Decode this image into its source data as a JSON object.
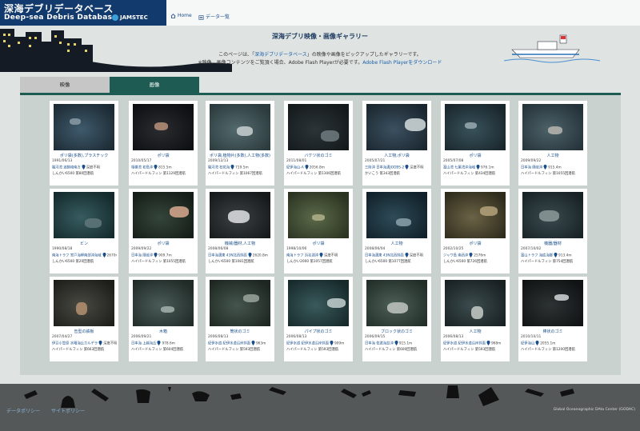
{
  "header": {
    "title_ja": "深海デブリデータベース",
    "title_en": "Deep-sea Debris Database",
    "org": "JAMSTEC",
    "nav": [
      {
        "label": "Home"
      },
      {
        "label": "データ一覧"
      }
    ]
  },
  "page": {
    "title": "深海デブリ映像・画像ギャラリー",
    "intro_before": "このページは、「",
    "intro_link": "深海デブリデータベース",
    "intro_after": "」の映像や画像をピックアップしたギャラリーです。",
    "note": "※映像、画像コンテンツをご覧頂く場合、Adobe Flash Playerが必要です。",
    "note_link": "Adobe Flash Playerをダウンロード"
  },
  "tabs": [
    {
      "label": "映像",
      "active": false
    },
    {
      "label": "画像",
      "active": true
    }
  ],
  "gallery": [
    {
      "title": "ポリ袋(多数),プラスチック",
      "date": "1991/06/13",
      "location": "駿河湾 波勝崎南方",
      "depth": "深度不明",
      "vehicle": "しんかい6500 第80回潜航"
    },
    {
      "title": "ポリ袋",
      "date": "2010/05/17",
      "location": "相模湾 初島沖",
      "depth": "815.5m",
      "vehicle": "ハイパードルフィン 第1129回潜航"
    },
    {
      "title": "ポリ袋,植物片(多数),人工物(多数)",
      "date": "2009/12/13",
      "location": "駿河湾 石花海",
      "depth": "719.5m",
      "vehicle": "ハイパードルフィン 第1067回潜航"
    },
    {
      "title": "バケツ状のゴミ",
      "date": "2011/08/01",
      "location": "紀伊海山-A",
      "depth": "2056.8m",
      "vehicle": "ハイパードルフィン 第1306回潜航"
    },
    {
      "title": "人工物,ポリ袋",
      "date": "2005/07/21",
      "location": "三陸沖 日本海溝JODBS-2",
      "depth": "深度不明",
      "vehicle": "かいこう 第343回潜航"
    },
    {
      "title": "ポリ袋",
      "date": "2005/07/08",
      "location": "富山湾 七尾湾沖海域",
      "depth": "976.1m",
      "vehicle": "ハイパードルフィン 第434回潜航"
    },
    {
      "title": "人工物",
      "date": "2009/09/22",
      "location": "日本海 隠岐沖",
      "depth": "915.4m",
      "vehicle": "ハイパードルフィン 第1055回潜航"
    },
    {
      "title": "ビン",
      "date": "1990/08/18",
      "location": "南海トラフ 室戸海岬南部沖海域",
      "depth": "2670m",
      "vehicle": "しんかい6500 第20回潜航"
    },
    {
      "title": "ポリ袋",
      "date": "2009/09/22",
      "location": "日本海 隠岐沖",
      "depth": "909.7m",
      "vehicle": "ハイパードルフィン 第1055回潜航"
    },
    {
      "title": "機械/器材,人工物",
      "date": "2008/06/08",
      "location": "日本海溝東 43N北西斜面",
      "depth": "2620.8m",
      "vehicle": "しんかい6500 第1081回潜航"
    },
    {
      "title": "ポリ袋",
      "date": "1998/10/06",
      "location": "南海トラフ 浜名湖沖",
      "depth": "深度不明",
      "vehicle": "しんかい2000 第1057回潜航"
    },
    {
      "title": "人工物",
      "date": "2008/06/04",
      "location": "日本海溝東 43N北西斜面",
      "depth": "深度不明",
      "vehicle": "しんかい6500 第1077回潜航"
    },
    {
      "title": "ポリ袋",
      "date": "2002/10/25",
      "location": "ジャワ島 南西沖",
      "depth": "2576m",
      "vehicle": "しんかい6500 第726回潜航"
    },
    {
      "title": "機器/器材",
      "date": "2007/10/02",
      "location": "富山トラフ 海底海脚",
      "depth": "913.4m",
      "vehicle": "ハイパードルフィン 第754回潜航"
    },
    {
      "title": "缶型の鉄板",
      "date": "2007/04/27",
      "location": "伊豆小笠原 水曜海丘カルデラ",
      "depth": "深度不明",
      "vehicle": "ハイパードルフィン 第663回潜航"
    },
    {
      "title": "木箱",
      "date": "2006/09/21",
      "location": "日本海 上越海丘",
      "depth": "978.6m",
      "vehicle": "ハイパードルフィン 第604回潜航"
    },
    {
      "title": "筒状のゴミ",
      "date": "2006/08/13",
      "location": "紀伊水道 紀伊水道沿岸斜面",
      "depth": "963m",
      "vehicle": "ハイパードルフィン 第593回潜航"
    },
    {
      "title": "パイプ状のゴミ",
      "date": "2006/08/13",
      "location": "紀伊水道 紀伊水道沿岸斜面",
      "depth": "909m",
      "vehicle": "ハイパードルフィン 第593回潜航"
    },
    {
      "title": "ブロック状のゴミ",
      "date": "2006/09/15",
      "location": "日本海 佐渡海盆沖",
      "depth": "915.1m",
      "vehicle": "ハイパードルフィン 第600回潜航"
    },
    {
      "title": "人工物",
      "date": "2006/08/13",
      "location": "紀伊水道 紀伊水道沿岸斜面",
      "depth": "968m",
      "vehicle": "ハイパードルフィン 第593回潜航"
    },
    {
      "title": "棒状のゴミ",
      "date": "2010/10/11",
      "location": "紀伊海山",
      "depth": "2055.1m",
      "vehicle": "ハイパードルフィン 第1200回潜航"
    }
  ],
  "footer": {
    "links": [
      {
        "label": "データポリシー"
      },
      {
        "label": "サイトポリシー"
      }
    ],
    "credit": "Global Oceanographic DAta Center (GODAC)"
  },
  "colors": {
    "header_navy": "#123a6c",
    "tab_active": "#1e5b52",
    "panel_bg": "#c9d2cf",
    "link": "#1a5fa8",
    "footer_bg": "#555859"
  }
}
